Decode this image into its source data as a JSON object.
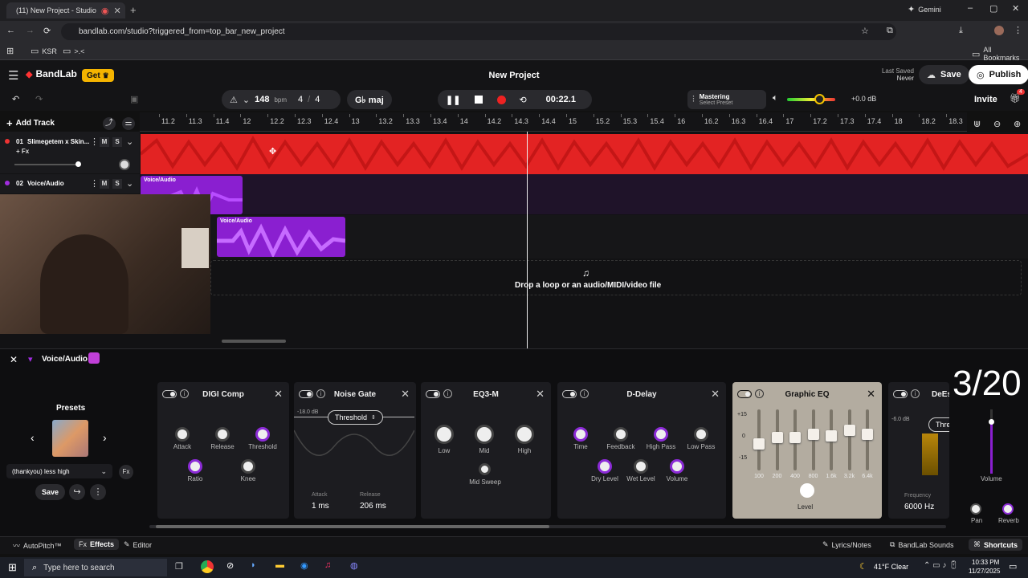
{
  "browser": {
    "tab_title": "(11) New Project - Studio",
    "gemini_label": "Gemini",
    "url": "bandlab.com/studio?triggered_from=top_bar_new_project",
    "bookmarks": [
      "KSR",
      ">.<"
    ],
    "all_bookmarks": "All Bookmarks"
  },
  "app": {
    "brand": "BandLab",
    "get_label": "Get",
    "project_title": "New Project",
    "last_saved_label": "Last Saved",
    "last_saved_value": "Never",
    "save_label": "Save",
    "publish_label": "Publish"
  },
  "toolbar": {
    "bpm": "148",
    "bpm_unit": "bpm",
    "time_sig_num": "4",
    "time_sig_den": "4",
    "key": "G♭ maj",
    "time": "00:22.1",
    "mastering_title": "Mastering",
    "mastering_preset": "Select Preset",
    "gain": "+0.0 dB",
    "invite": "Invite",
    "notif_count": "4",
    "add_track": "Add Track"
  },
  "ruler": [
    "11.2",
    "11.3",
    "11.4",
    "12",
    "12.2",
    "12.3",
    "12.4",
    "13",
    "13.2",
    "13.3",
    "13.4",
    "14",
    "14.2",
    "14.3",
    "14.4",
    "15",
    "15.2",
    "15.3",
    "15.4",
    "16",
    "16.2",
    "16.3",
    "16.4",
    "17",
    "17.2",
    "17.3",
    "17.4",
    "18",
    "18.2",
    "18.3"
  ],
  "tracks": [
    {
      "num": "01",
      "name": "Slimegetem x Skin...",
      "fx": "+ Fx",
      "m": "M",
      "s": "S"
    },
    {
      "num": "02",
      "name": "Voice/Audio",
      "m": "M",
      "s": "S"
    }
  ],
  "clips": {
    "clip1": "Voice/Audio",
    "clip2": "Voice/Audio"
  },
  "drop_text": "Drop a loop or an audio/MIDI/video file",
  "effects_panel": {
    "track_name": "Voice/Audio",
    "presets_label": "Presets",
    "preset_value": "(thankyou) less high",
    "save_label": "Save",
    "counter": "3/20",
    "digi": {
      "title": "DIGI Comp",
      "labels": [
        "Attack",
        "Release",
        "Threshold",
        "Ratio",
        "Knee"
      ]
    },
    "gate": {
      "title": "Noise Gate",
      "db": "-18.0 dB",
      "mode": "Threshold",
      "attack_label": "Attack",
      "attack_val": "1 ms",
      "release_label": "Release",
      "release_val": "206 ms"
    },
    "eq3": {
      "title": "EQ3-M",
      "labels": [
        "Low",
        "Mid",
        "High",
        "Mid Sweep"
      ]
    },
    "delay": {
      "title": "D-Delay",
      "labels": [
        "Time",
        "Feedback",
        "High Pass",
        "Low Pass",
        "Dry Level",
        "Wet Level",
        "Volume"
      ]
    },
    "geq": {
      "title": "Graphic EQ",
      "scale": [
        "+15",
        "0",
        "-15"
      ],
      "bands": [
        "100",
        "200",
        "400",
        "800",
        "1.6k",
        "3.2k",
        "6.4k"
      ],
      "level": "Level"
    },
    "deess": {
      "title": "DeEss",
      "db": "-6.0 dB",
      "mode": "Thresho",
      "freq_label": "Frequency",
      "freq_val": "6000 Hz"
    },
    "master": {
      "volume": "Volume",
      "pan": "Pan",
      "reverb": "Reverb"
    }
  },
  "footer": {
    "autopitch": "AutoPitch™",
    "effects": "Effects",
    "editor": "Editor",
    "lyrics": "Lyrics/Notes",
    "sounds": "BandLab Sounds",
    "shortcuts": "Shortcuts"
  },
  "taskbar": {
    "search": "Type here to search",
    "weather": "41°F Clear",
    "time": "10:33 PM",
    "date": "11/27/2025"
  }
}
